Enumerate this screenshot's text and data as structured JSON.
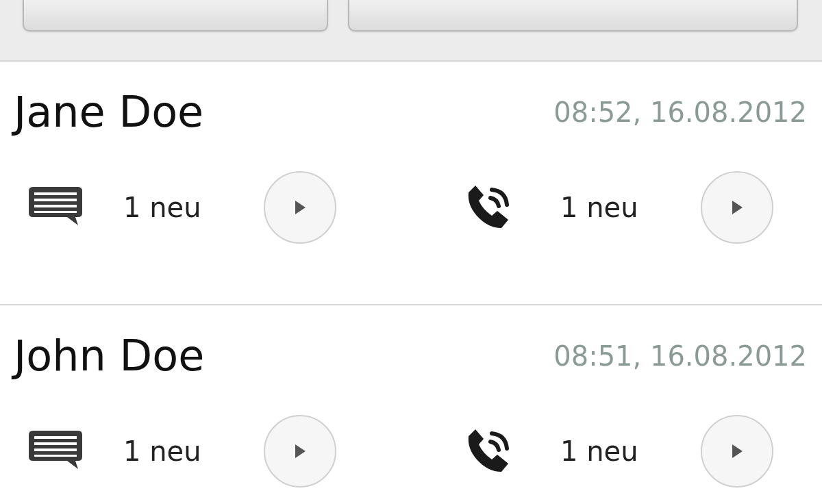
{
  "entries": [
    {
      "name": "Jane Doe",
      "time": "08:52, 16.08.2012",
      "messages": "1 neu",
      "calls": "1 neu"
    },
    {
      "name": "John Doe",
      "time": "08:51, 16.08.2012",
      "messages": "1 neu",
      "calls": "1 neu"
    }
  ]
}
